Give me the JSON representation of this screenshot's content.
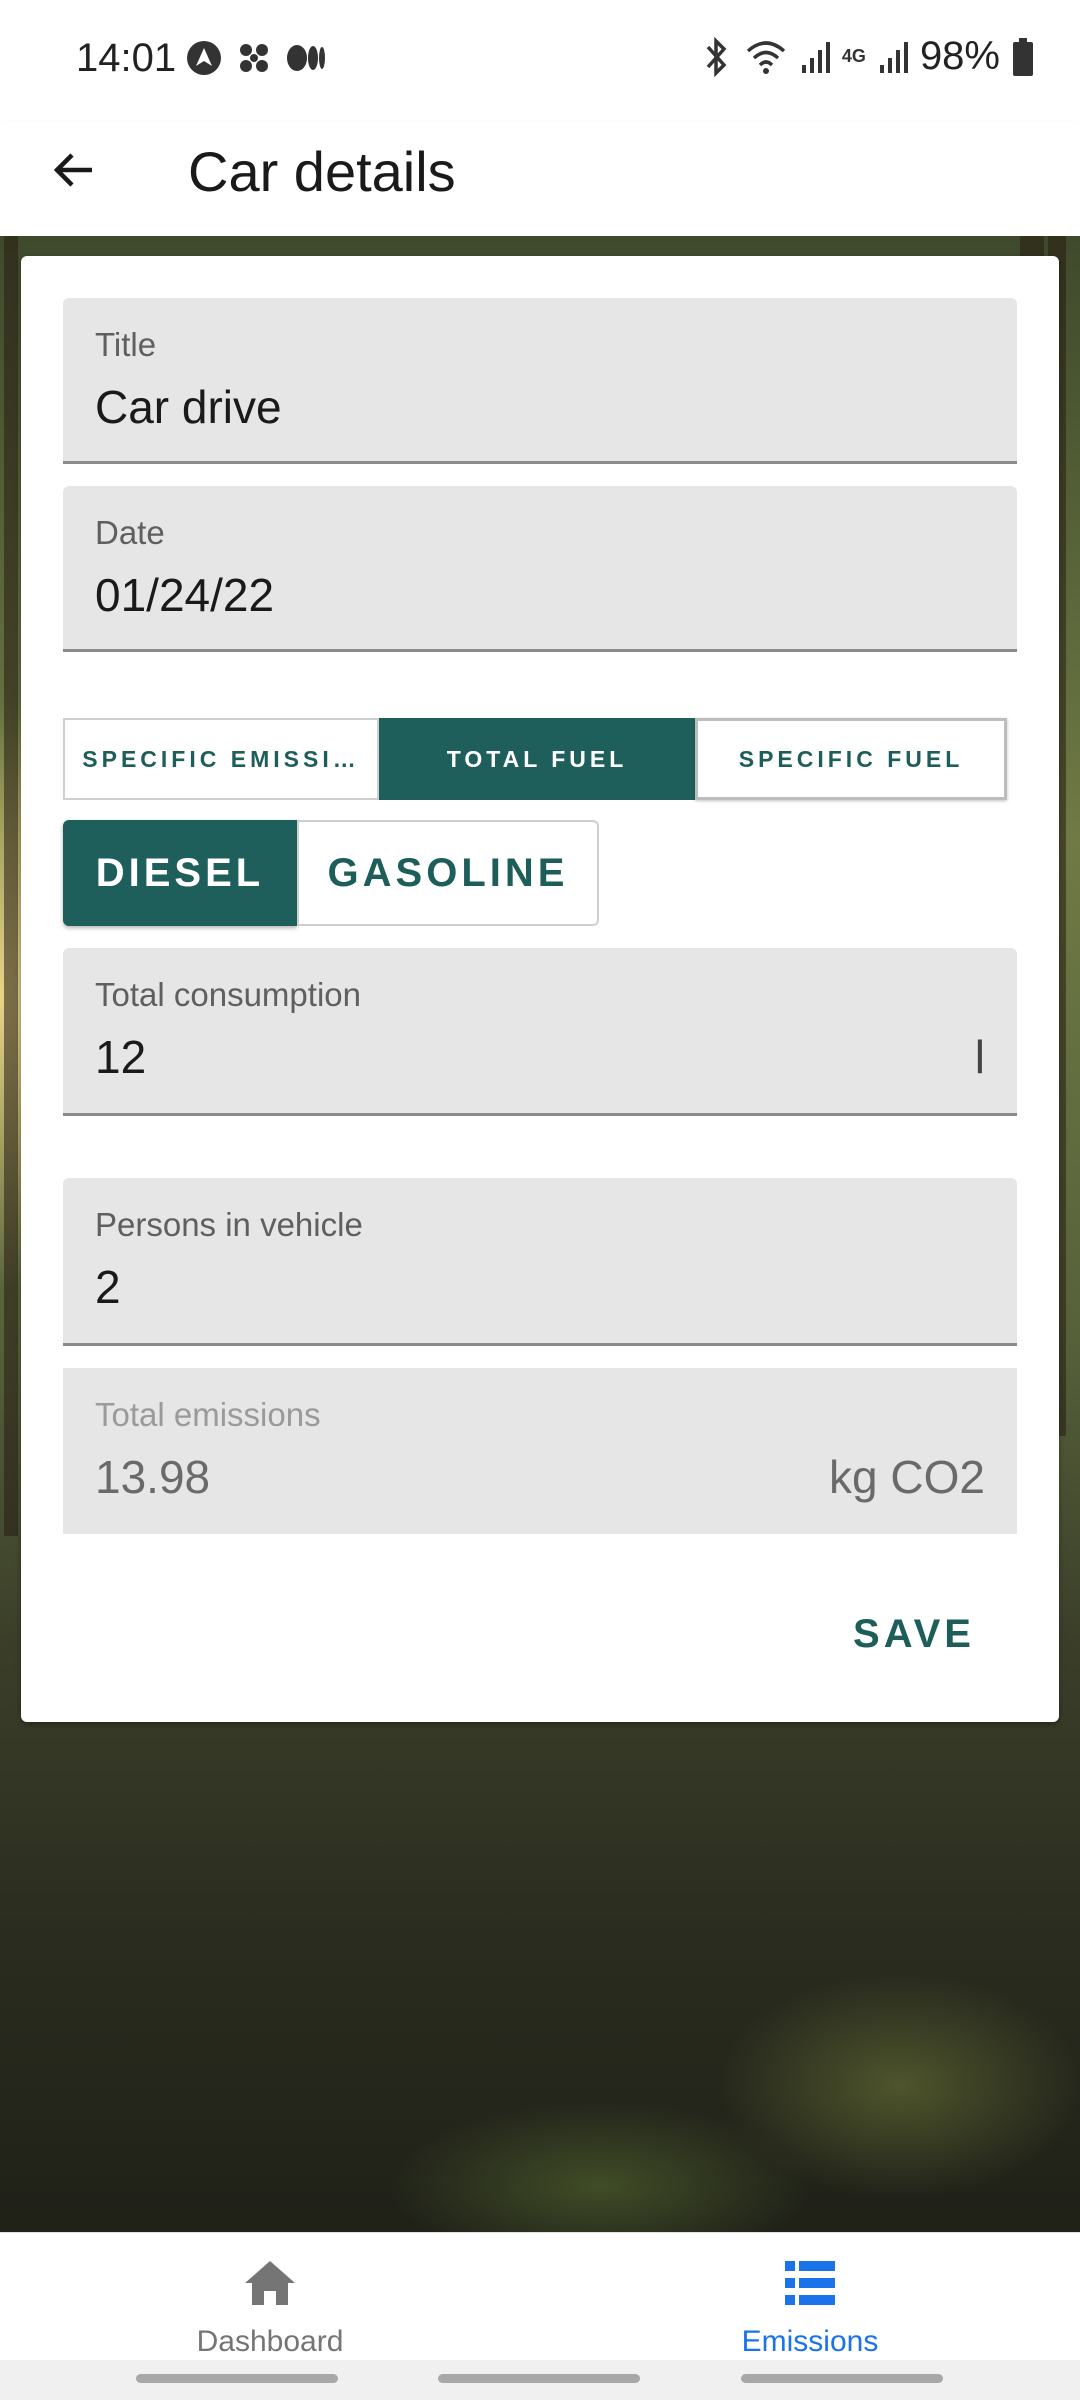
{
  "status_bar": {
    "time": "14:01",
    "battery": "98%",
    "network": "4G"
  },
  "app_bar": {
    "title": "Car details"
  },
  "form": {
    "title": {
      "label": "Title",
      "value": "Car drive"
    },
    "date": {
      "label": "Date",
      "value": "01/24/22"
    },
    "mode_options": [
      {
        "label": "SPECIFIC EMISSI…",
        "active": false
      },
      {
        "label": "TOTAL FUEL",
        "active": true
      },
      {
        "label": "SPECIFIC FUEL",
        "active": false
      }
    ],
    "fuel_options": [
      {
        "label": "DIESEL",
        "active": true
      },
      {
        "label": "GASOLINE",
        "active": false
      }
    ],
    "total_consumption": {
      "label": "Total consumption",
      "value": "12",
      "unit": "l"
    },
    "persons": {
      "label": "Persons in vehicle",
      "value": "2"
    },
    "total_emissions": {
      "label": "Total emissions",
      "value": "13.98",
      "unit": "kg CO2"
    },
    "save_label": "SAVE"
  },
  "bottom_nav": {
    "items": [
      {
        "label": "Dashboard",
        "icon": "home-icon",
        "active": false
      },
      {
        "label": "Emissions",
        "icon": "list-icon",
        "active": true
      }
    ]
  },
  "colors": {
    "accent": "#1f5f5b",
    "nav_active": "#1a73e8",
    "nav_inactive": "#757575"
  }
}
